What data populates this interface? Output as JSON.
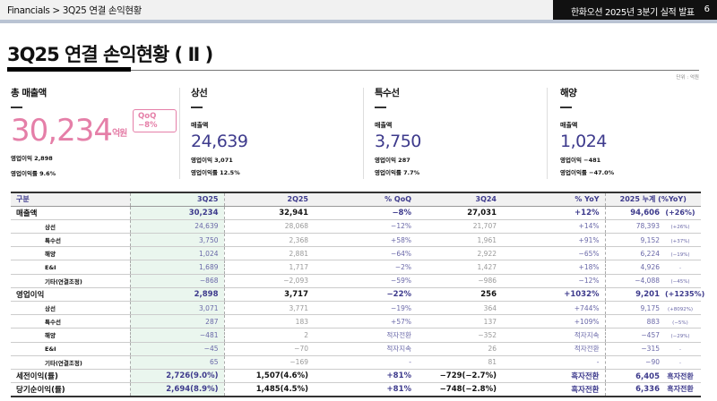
{
  "header": {
    "breadcrumb": "Financials > 3Q25 연결 손익현황",
    "report": "한화오션 2025년 3분기 실적 발표",
    "page": "6"
  },
  "title": "3Q25 연결 손익현황 ( Ⅱ )",
  "unit": "단위 : 억원",
  "cards": {
    "total": {
      "title": "총 매출액",
      "value": "30,234",
      "suffix": "억원",
      "badge": "QoQ −8%",
      "op": "영업이익  2,898",
      "margin": "영업이익률  9.6%"
    },
    "merchant": {
      "title": "상선",
      "label": "매출액",
      "value": "24,639",
      "op": "영업이익  3,071",
      "margin": "영업이익률  12.5%"
    },
    "special": {
      "title": "특수선",
      "label": "매출액",
      "value": "3,750",
      "op": "영업이익  287",
      "margin": "영업이익률  7.7%"
    },
    "offshore": {
      "title": "해양",
      "label": "매출액",
      "value": "1,024",
      "op": "영업이익  −481",
      "margin": "영업이익률  −47.0%"
    }
  },
  "table": {
    "headers": [
      "구분",
      "3Q25",
      "2Q25",
      "% QoQ",
      "3Q24",
      "% YoY",
      "2025 누계 (%YoY)"
    ],
    "rows": [
      {
        "type": "main",
        "cells": [
          "매출액",
          "30,234",
          "32,941",
          "−8%",
          "27,031",
          "+12%",
          "94,606",
          "(+26%)"
        ]
      },
      {
        "type": "sub",
        "cells": [
          "상선",
          "24,639",
          "28,068",
          "−12%",
          "21,707",
          "+14%",
          "78,393",
          "(+26%)"
        ]
      },
      {
        "type": "sub",
        "cells": [
          "특수선",
          "3,750",
          "2,368",
          "+58%",
          "1,961",
          "+91%",
          "9,152",
          "(+37%)"
        ]
      },
      {
        "type": "sub",
        "cells": [
          "해양",
          "1,024",
          "2,881",
          "−64%",
          "2,922",
          "−65%",
          "6,224",
          "(−19%)"
        ]
      },
      {
        "type": "sub",
        "cells": [
          "E&I",
          "1,689",
          "1,717",
          "−2%",
          "1,427",
          "+18%",
          "4,926",
          "-"
        ]
      },
      {
        "type": "sub",
        "cells": [
          "기타(연결조정)",
          "−868",
          "−2,093",
          "−59%",
          "−986",
          "−12%",
          "−4,088",
          "(−45%)"
        ]
      },
      {
        "type": "main",
        "cells": [
          "영업이익",
          "2,898",
          "3,717",
          "−22%",
          "256",
          "+1032%",
          "9,201",
          "(+1235%)"
        ]
      },
      {
        "type": "sub",
        "cells": [
          "상선",
          "3,071",
          "3,771",
          "−19%",
          "364",
          "+744%",
          "9,175",
          "(+8092%)"
        ]
      },
      {
        "type": "sub",
        "cells": [
          "특수선",
          "287",
          "183",
          "+57%",
          "137",
          "+109%",
          "883",
          "(−5%)"
        ]
      },
      {
        "type": "sub",
        "cells": [
          "해양",
          "−481",
          "2",
          "적자전환",
          "−352",
          "적자지속",
          "−457",
          "(−29%)"
        ]
      },
      {
        "type": "sub",
        "cells": [
          "E&I",
          "−45",
          "−70",
          "적자지속",
          "26",
          "적자전환",
          "−315",
          "-"
        ]
      },
      {
        "type": "sub",
        "cells": [
          "기타(연결조정)",
          "65",
          "−169",
          "-",
          "81",
          "-",
          "−90",
          "-"
        ]
      },
      {
        "type": "main",
        "cells": [
          "세전이익(률)",
          "2,726(9.0%)",
          "1,507(4.6%)",
          "+81%",
          "−729(−2.7%)",
          "흑자전환",
          "6,405",
          "흑자전환"
        ]
      },
      {
        "type": "main",
        "cells": [
          "당기순이익(률)",
          "2,694(8.9%)",
          "1,485(4.5%)",
          "+81%",
          "−748(−2.8%)",
          "흑자전환",
          "6,336",
          "흑자전환"
        ]
      }
    ]
  }
}
